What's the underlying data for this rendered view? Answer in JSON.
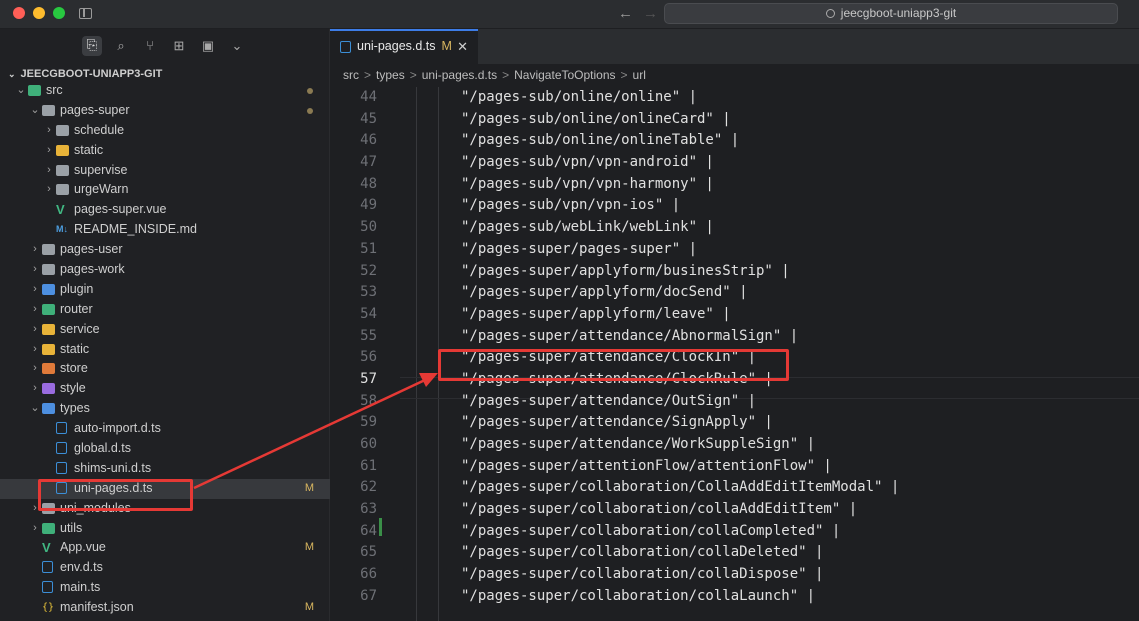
{
  "window": {
    "search_text": "jeecgboot-uniapp3-git",
    "nav_back": "←",
    "nav_forward": "→"
  },
  "explorer": {
    "workspace": "JEECGBOOT-UNIAPP3-GIT",
    "items": [
      {
        "label": "src",
        "depth": 0,
        "type": "folder-open",
        "color": "fold-g",
        "status": "dot"
      },
      {
        "label": "pages-super",
        "depth": 1,
        "type": "folder-open",
        "color": "fold",
        "status": "dot"
      },
      {
        "label": "schedule",
        "depth": 2,
        "type": "folder",
        "color": "fold",
        "status": ""
      },
      {
        "label": "static",
        "depth": 2,
        "type": "folder",
        "color": "fold-y",
        "status": ""
      },
      {
        "label": "supervise",
        "depth": 2,
        "type": "folder",
        "color": "fold",
        "status": ""
      },
      {
        "label": "urgeWarn",
        "depth": 2,
        "type": "folder",
        "color": "fold",
        "status": ""
      },
      {
        "label": "pages-super.vue",
        "depth": 2,
        "type": "vue",
        "status": ""
      },
      {
        "label": "README_INSIDE.md",
        "depth": 2,
        "type": "md",
        "status": ""
      },
      {
        "label": "pages-user",
        "depth": 1,
        "type": "folder",
        "color": "fold",
        "status": ""
      },
      {
        "label": "pages-work",
        "depth": 1,
        "type": "folder",
        "color": "fold",
        "status": ""
      },
      {
        "label": "plugin",
        "depth": 1,
        "type": "folder",
        "color": "fold-b",
        "status": ""
      },
      {
        "label": "router",
        "depth": 1,
        "type": "folder",
        "color": "fold-g",
        "status": ""
      },
      {
        "label": "service",
        "depth": 1,
        "type": "folder",
        "color": "fold-y",
        "status": ""
      },
      {
        "label": "static",
        "depth": 1,
        "type": "folder",
        "color": "fold-y",
        "status": ""
      },
      {
        "label": "store",
        "depth": 1,
        "type": "folder",
        "color": "fold-o",
        "status": ""
      },
      {
        "label": "style",
        "depth": 1,
        "type": "folder",
        "color": "fold-p",
        "status": ""
      },
      {
        "label": "types",
        "depth": 1,
        "type": "folder-open",
        "color": "fold-b",
        "status": ""
      },
      {
        "label": "auto-import.d.ts",
        "depth": 2,
        "type": "ts",
        "status": ""
      },
      {
        "label": "global.d.ts",
        "depth": 2,
        "type": "ts",
        "status": ""
      },
      {
        "label": "shims-uni.d.ts",
        "depth": 2,
        "type": "ts",
        "status": ""
      },
      {
        "label": "uni-pages.d.ts",
        "depth": 2,
        "type": "ts",
        "status": "M",
        "selected": true
      },
      {
        "label": "uni_modules",
        "depth": 1,
        "type": "folder",
        "color": "fold",
        "status": ""
      },
      {
        "label": "utils",
        "depth": 1,
        "type": "folder",
        "color": "fold-g",
        "status": ""
      },
      {
        "label": "App.vue",
        "depth": 1,
        "type": "vue",
        "status": "M"
      },
      {
        "label": "env.d.ts",
        "depth": 1,
        "type": "ts",
        "status": ""
      },
      {
        "label": "main.ts",
        "depth": 1,
        "type": "ts",
        "status": ""
      },
      {
        "label": "manifest.json",
        "depth": 1,
        "type": "json",
        "status": "M"
      }
    ]
  },
  "tab": {
    "label": "uni-pages.d.ts",
    "status": "M",
    "close": "✕"
  },
  "breadcrumb": {
    "parts": [
      "src",
      "types",
      "uni-pages.d.ts",
      "NavigateToOptions",
      "url"
    ],
    "separator": ">"
  },
  "code": {
    "current_line": 57,
    "lines": [
      {
        "n": 44,
        "text": "\"/pages-sub/online/online\" |"
      },
      {
        "n": 45,
        "text": "\"/pages-sub/online/onlineCard\" |"
      },
      {
        "n": 46,
        "text": "\"/pages-sub/online/onlineTable\" |"
      },
      {
        "n": 47,
        "text": "\"/pages-sub/vpn/vpn-android\" |"
      },
      {
        "n": 48,
        "text": "\"/pages-sub/vpn/vpn-harmony\" |"
      },
      {
        "n": 49,
        "text": "\"/pages-sub/vpn/vpn-ios\" |"
      },
      {
        "n": 50,
        "text": "\"/pages-sub/webLink/webLink\" |"
      },
      {
        "n": 51,
        "text": "\"/pages-super/pages-super\" |"
      },
      {
        "n": 52,
        "text": "\"/pages-super/applyform/businesStrip\" |"
      },
      {
        "n": 53,
        "text": "\"/pages-super/applyform/docSend\" |"
      },
      {
        "n": 54,
        "text": "\"/pages-super/applyform/leave\" |"
      },
      {
        "n": 55,
        "text": "\"/pages-super/attendance/AbnormalSign\" |"
      },
      {
        "n": 56,
        "text": "\"/pages-super/attendance/ClockIn\" |"
      },
      {
        "n": 57,
        "text": "\"/pages-super/attendance/ClockRule\" |"
      },
      {
        "n": 58,
        "text": "\"/pages-super/attendance/OutSign\" |"
      },
      {
        "n": 59,
        "text": "\"/pages-super/attendance/SignApply\" |"
      },
      {
        "n": 60,
        "text": "\"/pages-super/attendance/WorkSuppleSign\" |"
      },
      {
        "n": 61,
        "text": "\"/pages-super/attentionFlow/attentionFlow\" |"
      },
      {
        "n": 62,
        "text": "\"/pages-super/collaboration/CollaAddEditItemModal\" |"
      },
      {
        "n": 63,
        "text": "\"/pages-super/collaboration/collaAddEditItem\" |"
      },
      {
        "n": 64,
        "text": "\"/pages-super/collaboration/collaCompleted\" |"
      },
      {
        "n": 65,
        "text": "\"/pages-super/collaboration/collaDeleted\" |"
      },
      {
        "n": 66,
        "text": "\"/pages-super/collaboration/collaDispose\" |"
      },
      {
        "n": 67,
        "text": "\"/pages-super/collaboration/collaLaunch\" |"
      }
    ]
  },
  "annotation_color": "#e53935"
}
